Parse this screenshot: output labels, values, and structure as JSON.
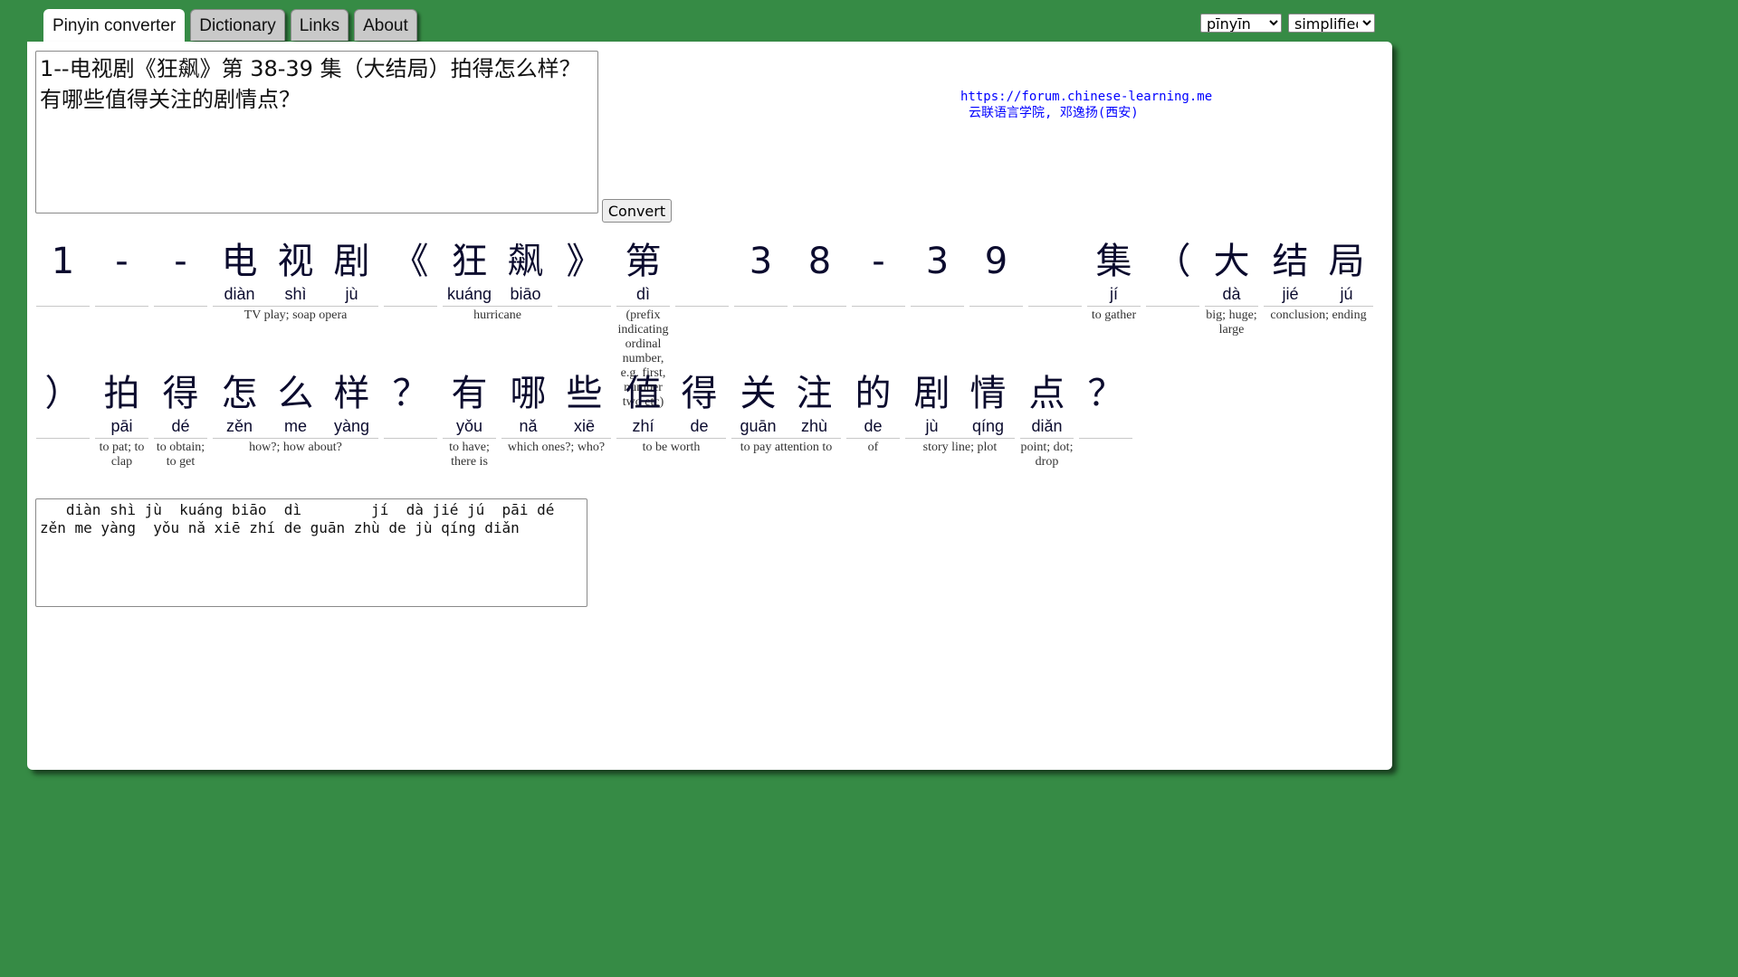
{
  "tabs": [
    {
      "label": "Pinyin converter",
      "active": true
    },
    {
      "label": "Dictionary",
      "active": false
    },
    {
      "label": "Links",
      "active": false
    },
    {
      "label": "About",
      "active": false
    }
  ],
  "selects": {
    "romanization": {
      "value": "pīnyīn"
    },
    "script": {
      "value": "simplified"
    }
  },
  "input_text": "1--电视剧《狂飙》第 38-39 集（大结局）拍得怎么样？有哪些值得关注的剧情点？",
  "convert_label": "Convert",
  "info": {
    "url": "https://forum.chinese-learning.me",
    "credit": "云联语言学院, 邓逸扬(西安)"
  },
  "rows": [
    [
      {
        "chars": [
          {
            "hz": "1",
            "py": ""
          }
        ],
        "gloss": ""
      },
      {
        "chars": [
          {
            "hz": "-",
            "py": ""
          }
        ],
        "gloss": ""
      },
      {
        "chars": [
          {
            "hz": "-",
            "py": ""
          }
        ],
        "gloss": ""
      },
      {
        "chars": [
          {
            "hz": "电",
            "py": "diàn"
          },
          {
            "hz": "视",
            "py": "shì"
          },
          {
            "hz": "剧",
            "py": "jù"
          }
        ],
        "gloss": "TV play; soap opera"
      },
      {
        "chars": [
          {
            "hz": "《",
            "py": ""
          }
        ],
        "gloss": ""
      },
      {
        "chars": [
          {
            "hz": "狂",
            "py": "kuáng"
          },
          {
            "hz": "飙",
            "py": "biāo"
          }
        ],
        "gloss": "hurricane"
      },
      {
        "chars": [
          {
            "hz": "》",
            "py": ""
          }
        ],
        "gloss": ""
      },
      {
        "chars": [
          {
            "hz": "第",
            "py": "dì"
          }
        ],
        "gloss": "(prefix indicating ordinal number, e.g. first, number two etc)"
      },
      {
        "chars": [
          {
            "hz": " ",
            "py": ""
          }
        ],
        "gloss": ""
      },
      {
        "chars": [
          {
            "hz": "3",
            "py": ""
          }
        ],
        "gloss": ""
      },
      {
        "chars": [
          {
            "hz": "8",
            "py": ""
          }
        ],
        "gloss": ""
      },
      {
        "chars": [
          {
            "hz": "-",
            "py": ""
          }
        ],
        "gloss": ""
      },
      {
        "chars": [
          {
            "hz": "3",
            "py": ""
          }
        ],
        "gloss": ""
      },
      {
        "chars": [
          {
            "hz": "9",
            "py": ""
          }
        ],
        "gloss": ""
      },
      {
        "chars": [
          {
            "hz": " ",
            "py": ""
          }
        ],
        "gloss": ""
      },
      {
        "chars": [
          {
            "hz": "集",
            "py": "jí"
          }
        ],
        "gloss": "to gather"
      },
      {
        "chars": [
          {
            "hz": "（",
            "py": ""
          }
        ],
        "gloss": ""
      },
      {
        "chars": [
          {
            "hz": "大",
            "py": "dà"
          }
        ],
        "gloss": "big; huge; large"
      },
      {
        "chars": [
          {
            "hz": "结",
            "py": "jié"
          },
          {
            "hz": "局",
            "py": "jú"
          }
        ],
        "gloss": "conclusion; ending"
      }
    ],
    [
      {
        "chars": [
          {
            "hz": "）",
            "py": ""
          }
        ],
        "gloss": ""
      },
      {
        "chars": [
          {
            "hz": "拍",
            "py": "pāi"
          }
        ],
        "gloss": "to pat; to clap"
      },
      {
        "chars": [
          {
            "hz": "得",
            "py": "dé"
          }
        ],
        "gloss": "to obtain; to get"
      },
      {
        "chars": [
          {
            "hz": "怎",
            "py": "zěn"
          },
          {
            "hz": "么",
            "py": "me"
          },
          {
            "hz": "样",
            "py": "yàng"
          }
        ],
        "gloss": "how?; how about?"
      },
      {
        "chars": [
          {
            "hz": "？",
            "py": ""
          }
        ],
        "gloss": ""
      },
      {
        "chars": [
          {
            "hz": "有",
            "py": "yǒu"
          }
        ],
        "gloss": "to have; there is"
      },
      {
        "chars": [
          {
            "hz": "哪",
            "py": "nǎ"
          },
          {
            "hz": "些",
            "py": "xiē"
          }
        ],
        "gloss": "which ones?; who?"
      },
      {
        "chars": [
          {
            "hz": "值",
            "py": "zhí"
          },
          {
            "hz": "得",
            "py": "de"
          }
        ],
        "gloss": "to be worth"
      },
      {
        "chars": [
          {
            "hz": "关",
            "py": "guān"
          },
          {
            "hz": "注",
            "py": "zhù"
          }
        ],
        "gloss": "to pay attention to"
      },
      {
        "chars": [
          {
            "hz": "的",
            "py": "de"
          }
        ],
        "gloss": "of"
      },
      {
        "chars": [
          {
            "hz": "剧",
            "py": "jù"
          },
          {
            "hz": "情",
            "py": "qíng"
          }
        ],
        "gloss": "story line; plot"
      },
      {
        "chars": [
          {
            "hz": "点",
            "py": "diǎn"
          }
        ],
        "gloss": "point; dot; drop"
      },
      {
        "chars": [
          {
            "hz": "？",
            "py": ""
          }
        ],
        "gloss": ""
      }
    ]
  ],
  "output_text": "   diàn shì jù  kuáng biāo  dì        jí  dà jié jú  pāi dé zěn me yàng  yǒu nǎ xiē zhí de guān zhù de jù qíng diǎn"
}
